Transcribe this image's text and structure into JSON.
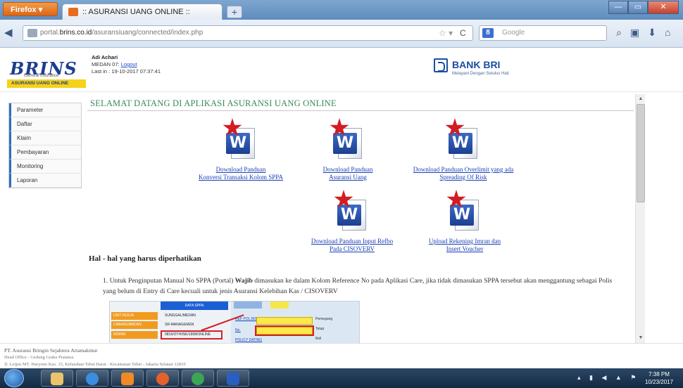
{
  "browser": {
    "menu_label": "Firefox",
    "tab_title": ":: ASURANSI UANG ONLINE ::",
    "url_prefix": "portal.",
    "url_domain": "brins.co.id",
    "url_path": "/asuransiuang/connected/index.php",
    "search_placeholder": "Google"
  },
  "header": {
    "brand": "BRINS",
    "brand_tagline": "General Insurance",
    "brand_band": "ASURANSI UANG ONLINE",
    "user_name": "Adi Achari",
    "user_branch": "MEDAN 07:",
    "logout_label": "Logout",
    "last_login": "Last in : 19-10-2017 07:37:41",
    "bank_name": "BANK BRI",
    "bank_tagline": "Melayani Dengan Setulus Hati"
  },
  "sidebar": {
    "items": [
      {
        "label": "Parameter"
      },
      {
        "label": "Daftar"
      },
      {
        "label": "Klaim"
      },
      {
        "label": "Pembayaran"
      },
      {
        "label": "Monitoring"
      },
      {
        "label": "Laporan"
      }
    ]
  },
  "main": {
    "welcome": "SELAMAT DATANG DI APLIKASI ASURANSI UANG ONLINE",
    "downloads": [
      {
        "line1": "Download Panduan",
        "line2": "Konversi Transaksi Kolom SPPA"
      },
      {
        "line1": "Download Panduan",
        "line2": "Asuransi Uang"
      },
      {
        "line1": "Download Panduan Overlimit yang ada",
        "line2": "Spreading Of Risk"
      },
      {
        "line1": "Download Panduan Input Refbo",
        "line2": "Pada CISOVERV"
      },
      {
        "line1": "Upload Rekening Imran dan",
        "line2": "Insert Voucher"
      }
    ],
    "notes_title": "Hal - hal yang harus diperhatikan",
    "note1_a": "1.  Untuk Penginputan Manual No SPPA (Portal) ",
    "note1_bold": "Wajib",
    "note1_b": " dimasukan ke dalam Kolom Reference No pada Aplikasi Care, jika tidak dimasukan SPPA tersebut akan menggantung sebagai Polis yang belum di Entry di Care kecuali untuk jenis Asuransi Kelebihan Kas / CISOVERV"
  },
  "mini_form": {
    "header": "DATA SPPA",
    "rows": [
      {
        "k": "UNIT KERJA",
        "v": "SUNGGAL/MEDAN"
      },
      {
        "k": "CABANG/BADAN",
        "v": "SR-MANAGEMEN"
      },
      {
        "k": "NOPAR",
        "v": "0816/OTH/ISK/1908/ONLINE"
      }
    ],
    "links": [
      "REF POL.NO",
      "No.",
      "POLICY DATING"
    ],
    "checks": [
      "Pemegang",
      "Tetap",
      "Bell"
    ]
  },
  "footer": {
    "company": "PT. Asuransi Bringin Sejahtera Artamakmur",
    "office": "Head Office - Gedung Graha Pratama",
    "address": "Jl. Letjen MT. Haryono Kav. 15, Kelurahan Tebet Barat - Kecamatan Tebet - Jakarta Selatan 12810"
  },
  "taskbar": {
    "time": "7:38 PM",
    "date": "10/23/2017"
  },
  "colors": {
    "welcome_green": "#3a8a5a",
    "link_blue": "#1b3fb3",
    "brand_blue": "#1c3d8f",
    "brand_yellow": "#f5d21b"
  }
}
